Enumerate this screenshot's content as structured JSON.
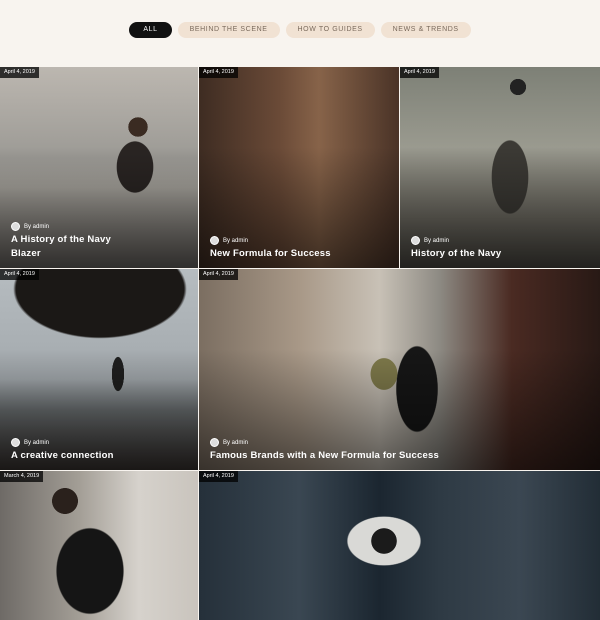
{
  "filters": [
    {
      "label": "ALL",
      "active": true
    },
    {
      "label": "BEHIND THE SCENE",
      "active": false
    },
    {
      "label": "HOW TO GUIDES",
      "active": false
    },
    {
      "label": "NEWS & TRENDS",
      "active": false
    }
  ],
  "posts": [
    {
      "date": "April 4, 2019",
      "author": "By admin",
      "title_lines": [
        "A History of the Navy",
        "Blazer"
      ]
    },
    {
      "date": "April 4, 2019",
      "author": "By admin",
      "title_lines": [
        "New Formula for Success"
      ]
    },
    {
      "date": "April 4, 2019",
      "author": "By admin",
      "title_lines": [
        "History of the Navy"
      ]
    },
    {
      "date": "April 4, 2019",
      "author": "By admin",
      "title_lines": [
        "A creative connection"
      ]
    },
    {
      "date": "April 4, 2019",
      "author": "By admin",
      "title_lines": [
        "Famous Brands with a New Formula for Success"
      ]
    },
    {
      "date": "March 4, 2019",
      "author": "",
      "title_lines": []
    },
    {
      "date": "April 4, 2019",
      "author": "",
      "title_lines": []
    }
  ]
}
